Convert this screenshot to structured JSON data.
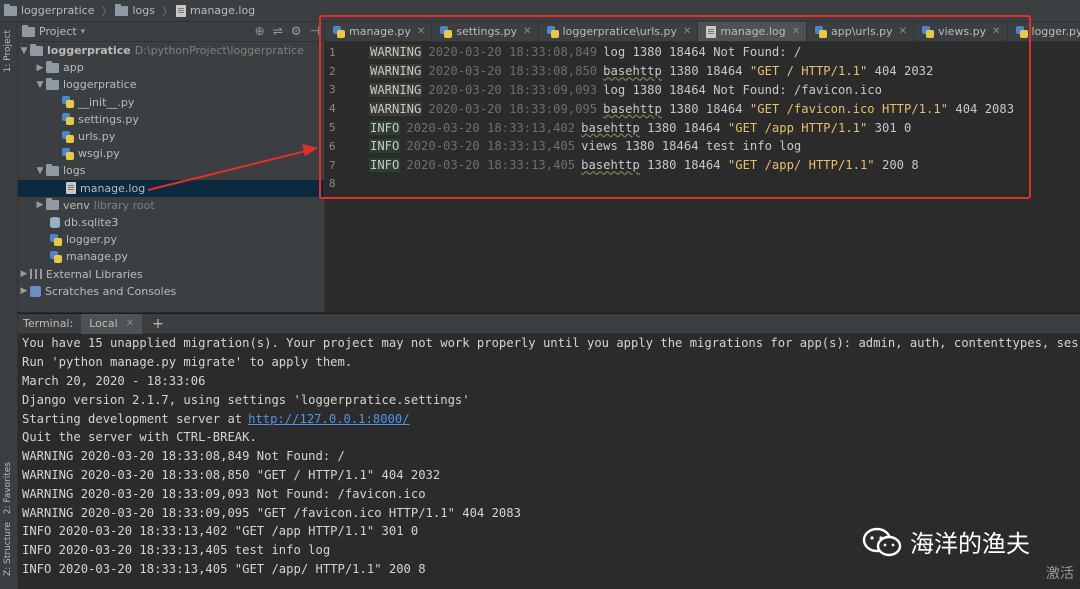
{
  "breadcrumb": [
    "loggerpratice",
    "logs",
    "manage.log"
  ],
  "left_strip": {
    "project_tab": "1: Project",
    "favorites_tab": "2: Favorites",
    "structure_tab": "Z: Structure"
  },
  "project_panel": {
    "title": "Project",
    "tree": [
      {
        "label": "loggerpratice",
        "extra": "D:\\pythonProject\\loggerpratice"
      },
      {
        "label": "app"
      },
      {
        "label": "loggerpratice"
      },
      {
        "label": "__init__.py"
      },
      {
        "label": "settings.py"
      },
      {
        "label": "urls.py"
      },
      {
        "label": "wsgi.py"
      },
      {
        "label": "logs"
      },
      {
        "label": "manage.log"
      },
      {
        "label": "venv",
        "extra": "library root"
      },
      {
        "label": "db.sqlite3"
      },
      {
        "label": "logger.py"
      },
      {
        "label": "manage.py"
      },
      {
        "label": "External Libraries"
      },
      {
        "label": "Scratches and Consoles"
      }
    ]
  },
  "editor": {
    "tabs": [
      "manage.py",
      "settings.py",
      "loggerpratice\\urls.py",
      "manage.log",
      "app\\urls.py",
      "views.py",
      "logger.py"
    ],
    "active_tab": "manage.log",
    "lines": [
      {
        "n": "1",
        "level": "WARNING",
        "ts": "2020-03-20 18:33:08,849",
        "logger": "log",
        "rest": "1380 18464 Not Found: /",
        "str": "",
        "tail": ""
      },
      {
        "n": "2",
        "level": "WARNING",
        "ts": "2020-03-20 18:33:08,850",
        "logger": "basehttp",
        "rest": "1380 18464",
        "str": "\"GET / HTTP/1.1\"",
        "tail": "404 2032"
      },
      {
        "n": "3",
        "level": "WARNING",
        "ts": "2020-03-20 18:33:09,093",
        "logger": "log",
        "rest": "1380 18464 Not Found: /favicon.ico",
        "str": "",
        "tail": ""
      },
      {
        "n": "4",
        "level": "WARNING",
        "ts": "2020-03-20 18:33:09,095",
        "logger": "basehttp",
        "rest": "1380 18464",
        "str": "\"GET /favicon.ico HTTP/1.1\"",
        "tail": "404 2083"
      },
      {
        "n": "5",
        "level": "INFO",
        "ts": "2020-03-20 18:33:13,402",
        "logger": "basehttp",
        "rest": "1380 18464",
        "str": "\"GET /app HTTP/1.1\"",
        "tail": "301 0"
      },
      {
        "n": "6",
        "level": "INFO",
        "ts": "2020-03-20 18:33:13,405",
        "logger": "views",
        "rest": "1380 18464 test info log",
        "str": "",
        "tail": ""
      },
      {
        "n": "7",
        "level": "INFO",
        "ts": "2020-03-20 18:33:13,405",
        "logger": "basehttp",
        "rest": "1380 18464",
        "str": "\"GET /app/ HTTP/1.1\"",
        "tail": "200 8"
      },
      {
        "n": "8",
        "level": "",
        "ts": "",
        "logger": "",
        "rest": "",
        "str": "",
        "tail": ""
      }
    ]
  },
  "terminal": {
    "label": "Terminal:",
    "tab": "Local",
    "plus": "+",
    "lines": [
      "You have 15 unapplied migration(s). Your project may not work properly until you apply the migrations for app(s): admin, auth, contenttypes, ses",
      "Run 'python manage.py migrate' to apply them.",
      "March 20, 2020 - 18:33:06",
      "Django version 2.1.7, using settings 'loggerpratice.settings'",
      "Starting development server at",
      "Quit the server with CTRL-BREAK.",
      "WARNING 2020-03-20 18:33:08,849 Not Found: /",
      "WARNING 2020-03-20 18:33:08,850 \"GET / HTTP/1.1\" 404 2032",
      "WARNING 2020-03-20 18:33:09,093 Not Found: /favicon.ico",
      "WARNING 2020-03-20 18:33:09,095 \"GET /favicon.ico HTTP/1.1\" 404 2083",
      "INFO 2020-03-20 18:33:13,402 \"GET /app HTTP/1.1\" 301 0",
      "INFO 2020-03-20 18:33:13,405 test info log",
      "INFO 2020-03-20 18:33:13,405 \"GET /app/ HTTP/1.1\" 200 8"
    ],
    "server_url": "http://127.0.0.1:8000/"
  },
  "watermark": {
    "text": "海洋的渔夫",
    "activate": "激活"
  },
  "colors": {
    "annotation": "#e0302d",
    "link": "#5394ec",
    "string": "#e8bf6a",
    "selection": "#0d293e"
  }
}
